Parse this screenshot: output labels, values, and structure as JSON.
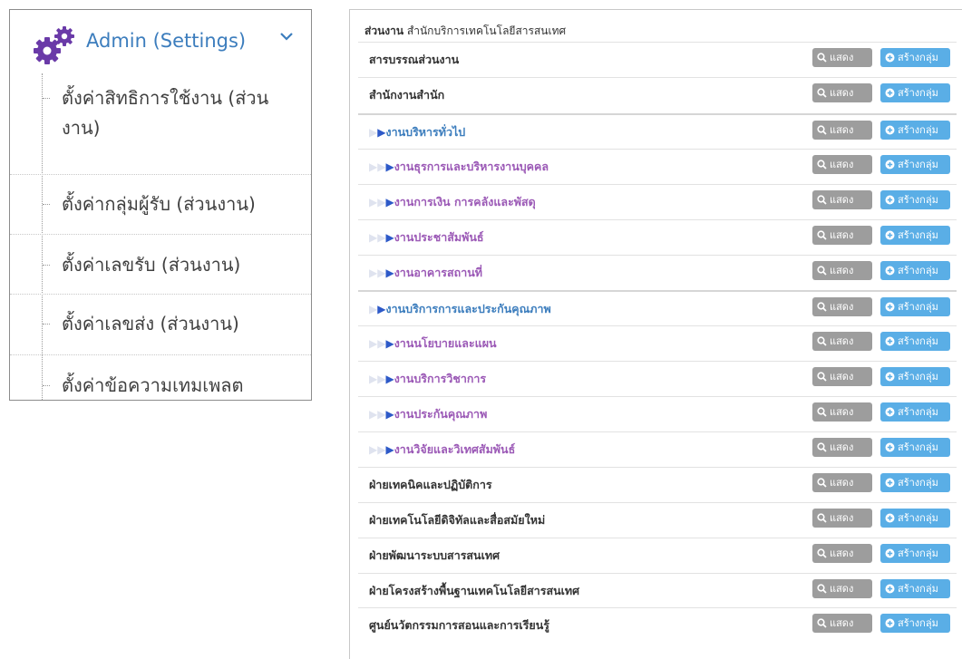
{
  "sidebar": {
    "title": "Admin (Settings)",
    "items": [
      {
        "label": "ตั้งค่าสิทธิการใช้งาน (ส่วนงาน)"
      },
      {
        "label": "ตั้งค่ากลุ่มผู้รับ (ส่วนงาน)"
      },
      {
        "label": "ตั้งค่าเลขรับ (ส่วนงาน)"
      },
      {
        "label": "ตั้งค่าเลขส่ง (ส่วนงาน)"
      },
      {
        "label": "ตั้งค่าข้อความเทมเพลต"
      }
    ]
  },
  "panel": {
    "title_prefix": "ส่วนงาน",
    "title_value": "สำนักบริการเทคโนโลยีสารสนเทศ",
    "show_label": "แสดง",
    "create_label": "สร้างกลุ่ม",
    "rows": [
      {
        "label": "สารบรรณส่วนงาน",
        "level": 0
      },
      {
        "label": "สำนักงานสำนัก",
        "level": 0
      },
      {
        "label": "งานบริหารทั่วไป",
        "level": 1
      },
      {
        "label": "งานธุรการและบริหารงานบุคคล",
        "level": 2
      },
      {
        "label": "งานการเงิน การคลังและพัสดุ",
        "level": 2
      },
      {
        "label": "งานประชาสัมพันธ์",
        "level": 2
      },
      {
        "label": "งานอาคารสถานที่",
        "level": 2
      },
      {
        "label": "งานบริการการและประกันคุณภาพ",
        "level": 1
      },
      {
        "label": "งานนโยบายและแผน",
        "level": 2
      },
      {
        "label": "งานบริการวิชาการ",
        "level": 2
      },
      {
        "label": "งานประกันคุณภาพ",
        "level": 2
      },
      {
        "label": "งานวิจัยและวิเทศสัมพันธ์",
        "level": 2
      },
      {
        "label": "ฝ่ายเทคนิคและปฏิบัติการ",
        "level": 0
      },
      {
        "label": "ฝ่ายเทคโนโลยีดิจิทัลและสื่อสมัยใหม่",
        "level": 0
      },
      {
        "label": "ฝ่ายพัฒนาระบบสารสนเทศ",
        "level": 0
      },
      {
        "label": "ฝ่ายโครงสร้างพื้นฐานเทคโนโลยีสารสนเทศ",
        "level": 0
      },
      {
        "label": "ศูนย์นวัตกรรมการสอนและการเรียนรู้",
        "level": 0
      }
    ]
  },
  "colors": {
    "accent_blue": "#3c7dbd",
    "purple": "#9b59b6",
    "gear": "#6a3aa8",
    "show_button": "#9d9d9d",
    "create_button": "#5aaee6"
  }
}
